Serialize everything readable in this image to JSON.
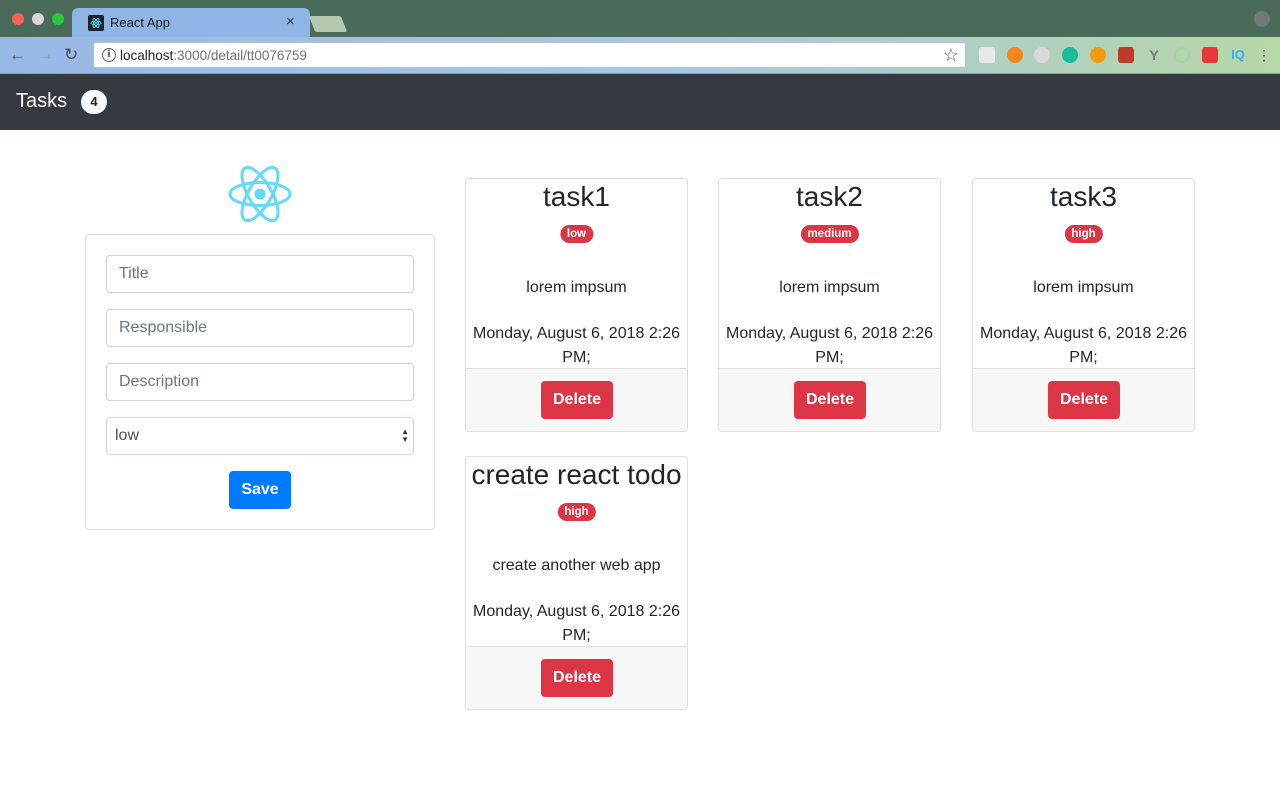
{
  "browser": {
    "tab_title": "React App",
    "tab_close": "×",
    "url_host": "localhost",
    "url_rest": ":3000/detail/tt0076759",
    "extension_icons": [
      "eyedropper-icon",
      "metamask-icon",
      "circle-ext-icon",
      "m-ext-icon",
      "fire-ext-icon",
      "red-ext-icon",
      "y-ext-icon",
      "ring-ext-icon",
      "cors-ext-icon",
      "iq-ext-icon",
      "more-icon"
    ]
  },
  "navbar": {
    "brand": "Tasks",
    "count": "4"
  },
  "form": {
    "title_placeholder": "Title",
    "responsible_placeholder": "Responsible",
    "description_placeholder": "Description",
    "priority_selected": "low",
    "save_label": "Save"
  },
  "tasks": [
    {
      "title": "task1",
      "priority": "low",
      "description": "lorem impsum",
      "date": "Monday, August 6, 2018 2:26 PM;",
      "delete_label": "Delete"
    },
    {
      "title": "task2",
      "priority": "medium",
      "description": "lorem impsum",
      "date": "Monday, August 6, 2018 2:26 PM;",
      "delete_label": "Delete"
    },
    {
      "title": "task3",
      "priority": "high",
      "description": "lorem impsum",
      "date": "Monday, August 6, 2018 2:26 PM;",
      "delete_label": "Delete"
    },
    {
      "title": "create react todo",
      "priority": "high",
      "description": "create another web app",
      "date": "Monday, August 6, 2018 2:26 PM;",
      "delete_label": "Delete"
    }
  ],
  "colors": {
    "navbar_bg": "#343a40",
    "primary": "#007bff",
    "danger": "#dc3545",
    "react_logo": "#61dafb"
  }
}
